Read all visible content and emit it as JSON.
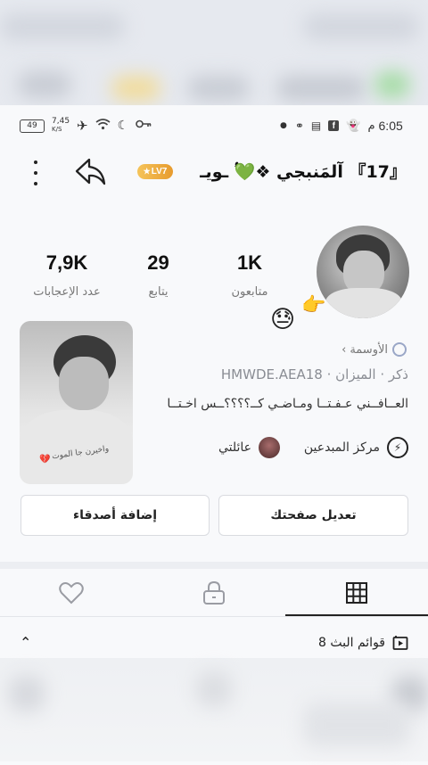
{
  "status_bar": {
    "time": "6:05",
    "ampm": "م",
    "battery": "49",
    "net_speed": "7,45",
    "net_unit": "K/S"
  },
  "header": {
    "username": "『17』 آلمَنبجي ❖💚ُ۟ ـويـ",
    "level": "LV7"
  },
  "stats": {
    "followers_num": "1K",
    "followers_label": "متابعون",
    "following_num": "29",
    "following_label": "يتابع",
    "likes_num": "7,9K",
    "likes_label": "عدد الإعجابات"
  },
  "profile": {
    "badges_link": "الأوسمة",
    "user_id": "HMWDE.AEA18",
    "gender": "ذكر",
    "zodiac": "الميزان",
    "bio": "ﺍﻟﻌــﺎﻓــﻨﻲ ﻋـﻔـﺘــﺎ ﻭﻣـﺎﺿـﻲ ﻛــ؟؟؟؟ــﺲ ﺍﺧـﺘــﺎ",
    "creator_center": "مركز المبدعين",
    "family": "عائلتي",
    "side_photo_caption": "واخيرن جا الموت"
  },
  "buttons": {
    "edit_profile": "تعديل صفحتك",
    "add_friends": "إضافة أصدقاء"
  },
  "tabs": {
    "active": "grid"
  },
  "playlists": {
    "label": "8 قوائم البث"
  },
  "colors": {
    "accent": "#222222",
    "gold": "#f0b44b",
    "emoji_yellow": "#ffcc3b"
  }
}
